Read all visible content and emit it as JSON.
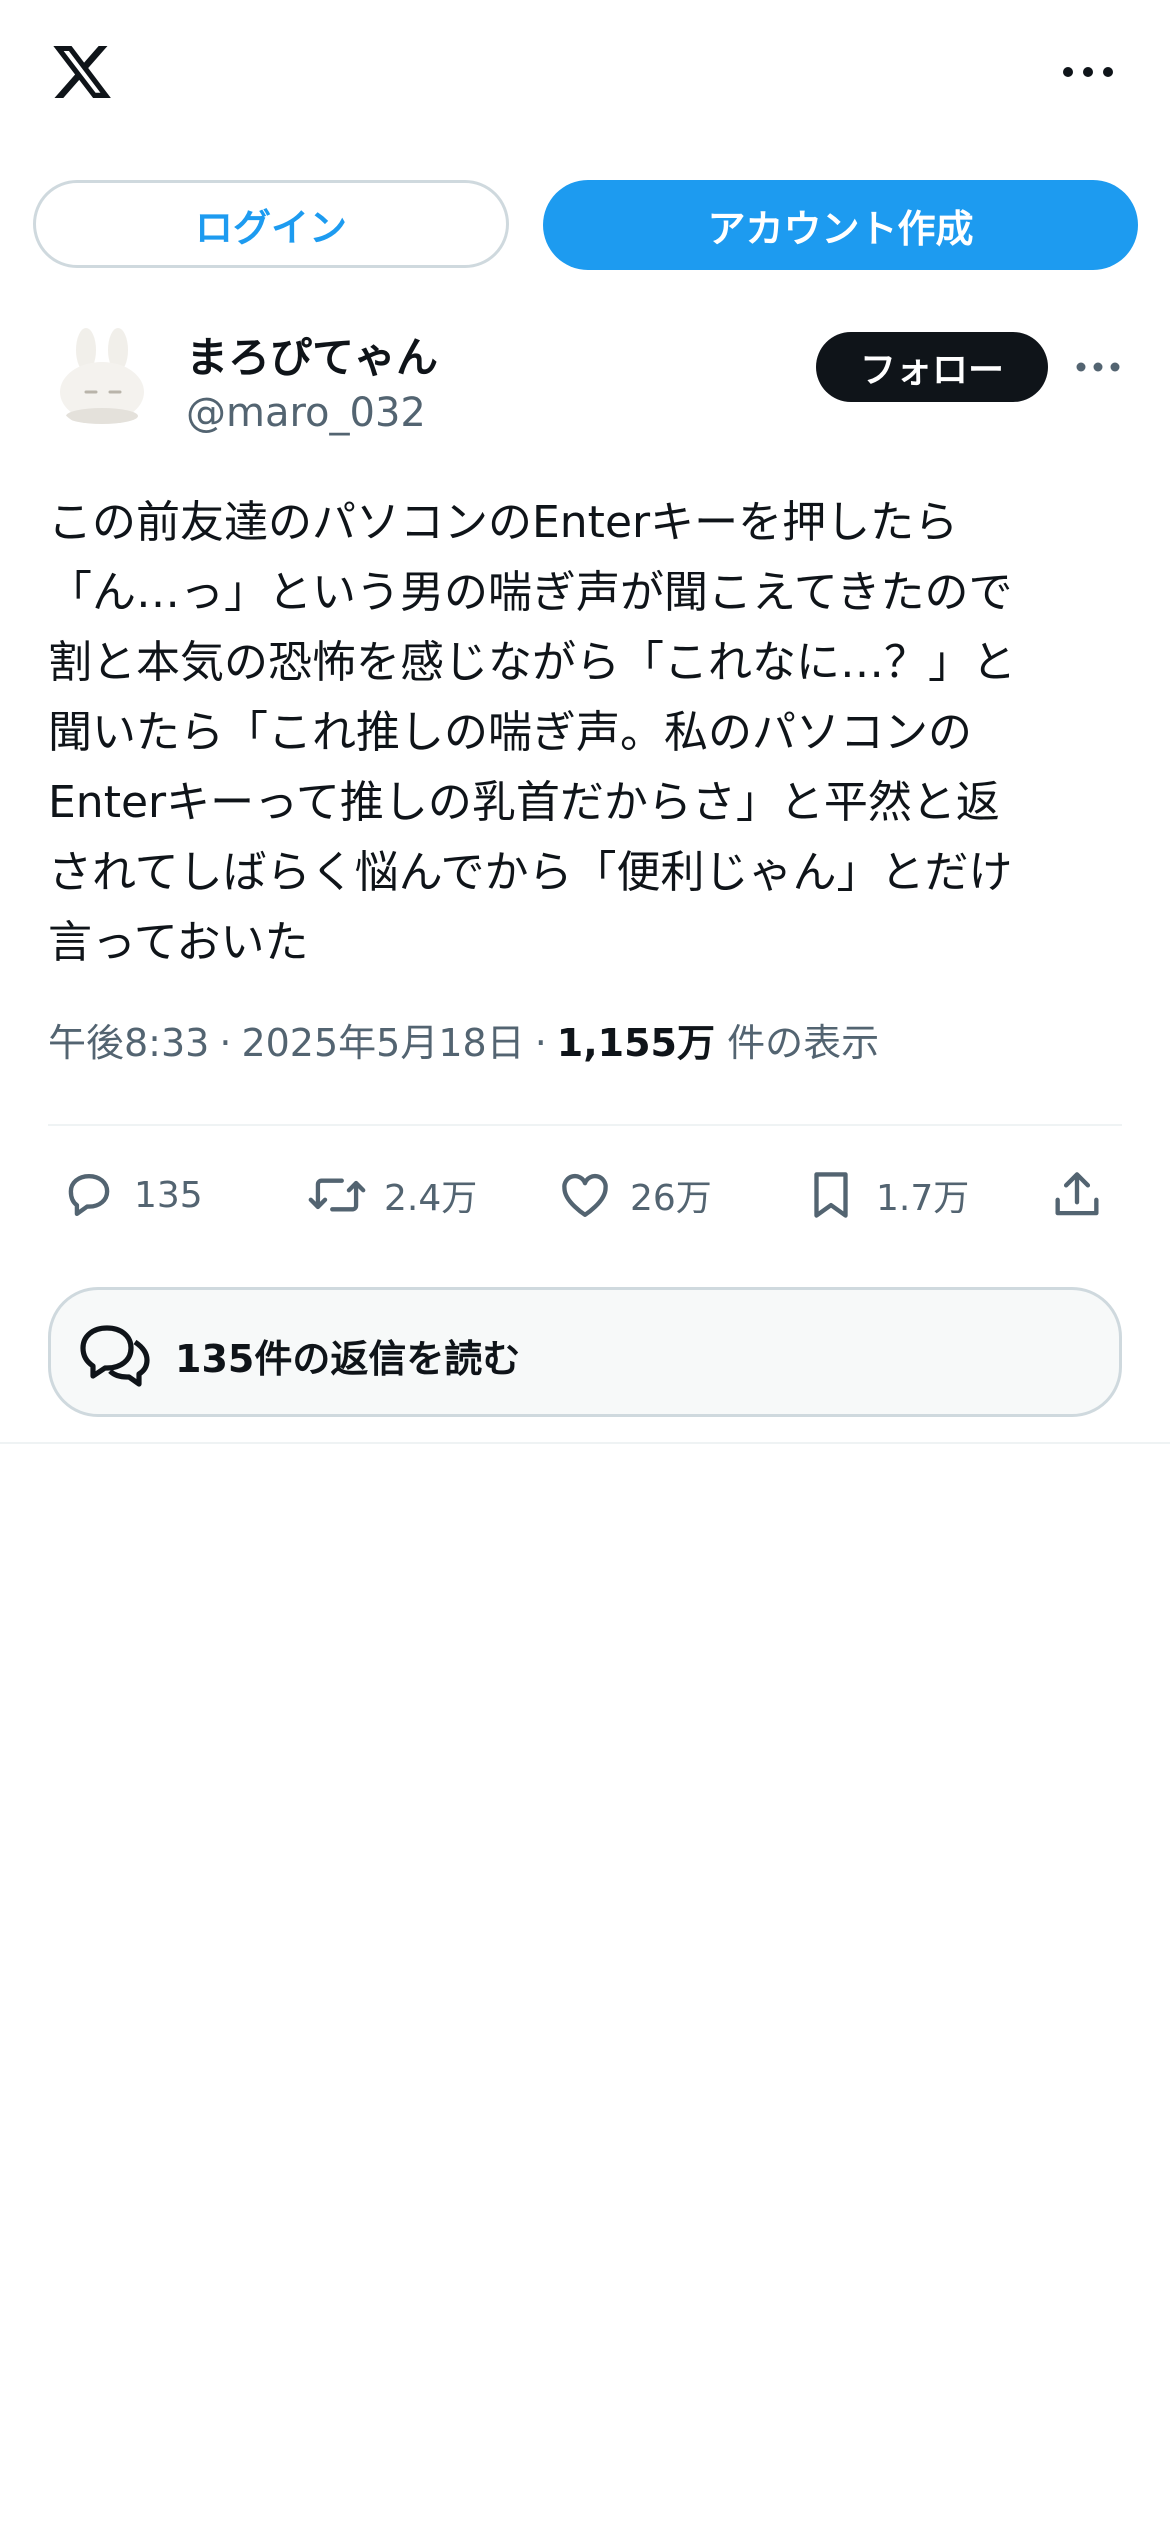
{
  "app": {
    "logo_icon": "x-logo-icon",
    "more_icon": "more-dots-icon"
  },
  "auth": {
    "login_label": "ログイン",
    "signup_label": "アカウント作成",
    "accent_color": "#1d9bf0"
  },
  "post": {
    "author_name": "まろぴてゃん",
    "author_handle": "@maro_032",
    "follow_label": "フォロー",
    "text": "この前友達のパソコンのEnterキーを押したら\n「ん…っ」という男の喘ぎ声が聞こえてきたので\n割と本気の恐怖を感じながら「これなに…？」と\n聞いたら「これ推しの喘ぎ声。私のパソコンの\nEnterキーって推しの乳首だからさ」と平然と返\nされてしばらく悩んでから「便利じゃん」とだけ\n言っておいた",
    "time": "午後8:33",
    "date": "2025年5月18日",
    "views_count": "1,155万",
    "views_label": "件の表示"
  },
  "actions": {
    "replies": "135",
    "reposts": "2.4万",
    "likes": "26万",
    "bookmarks": "1.7万"
  },
  "read_replies": {
    "label": "135件の返信を読む"
  }
}
